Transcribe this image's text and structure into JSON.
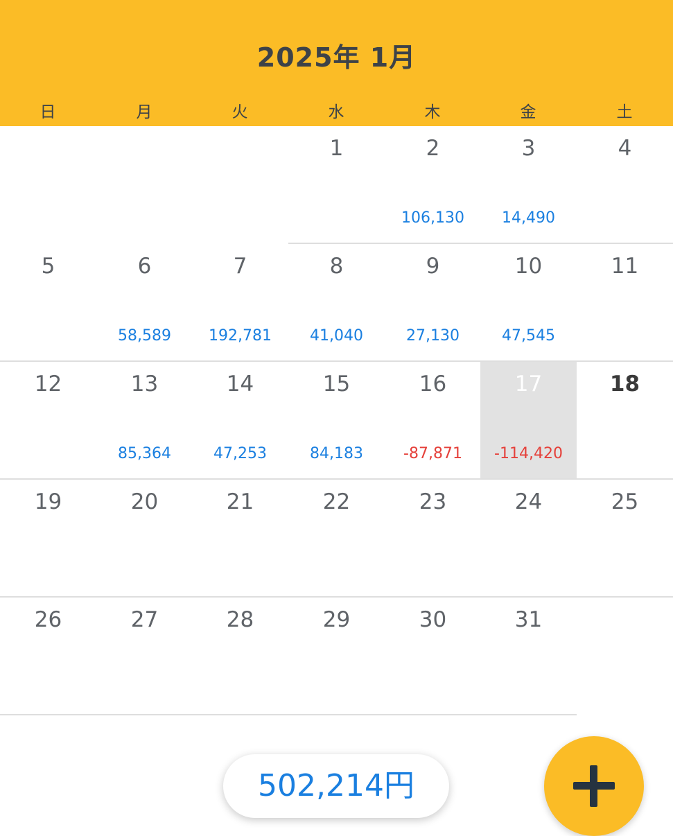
{
  "header": {
    "title": "2025年 1月"
  },
  "colors": {
    "accent": "#FBBC26",
    "positive": "#1a7fe0",
    "negative": "#e5403a",
    "selected": "#e2e2e2"
  },
  "weekdays": [
    "日",
    "月",
    "火",
    "水",
    "木",
    "金",
    "土"
  ],
  "calendar": {
    "weeks": [
      [
        {
          "day": "",
          "amount": ""
        },
        {
          "day": "",
          "amount": ""
        },
        {
          "day": "",
          "amount": ""
        },
        {
          "day": "1",
          "amount": ""
        },
        {
          "day": "2",
          "amount": "106,130"
        },
        {
          "day": "3",
          "amount": "14,490"
        },
        {
          "day": "4",
          "amount": ""
        }
      ],
      [
        {
          "day": "5",
          "amount": ""
        },
        {
          "day": "6",
          "amount": "58,589"
        },
        {
          "day": "7",
          "amount": "192,781"
        },
        {
          "day": "8",
          "amount": "41,040"
        },
        {
          "day": "9",
          "amount": "27,130"
        },
        {
          "day": "10",
          "amount": "47,545"
        },
        {
          "day": "11",
          "amount": ""
        }
      ],
      [
        {
          "day": "12",
          "amount": ""
        },
        {
          "day": "13",
          "amount": "85,364"
        },
        {
          "day": "14",
          "amount": "47,253"
        },
        {
          "day": "15",
          "amount": "84,183"
        },
        {
          "day": "16",
          "amount": "-87,871",
          "negative": true
        },
        {
          "day": "17",
          "amount": "-114,420",
          "negative": true,
          "selected": true
        },
        {
          "day": "18",
          "amount": "",
          "today": true
        }
      ],
      [
        {
          "day": "19",
          "amount": ""
        },
        {
          "day": "20",
          "amount": ""
        },
        {
          "day": "21",
          "amount": ""
        },
        {
          "day": "22",
          "amount": ""
        },
        {
          "day": "23",
          "amount": ""
        },
        {
          "day": "24",
          "amount": ""
        },
        {
          "day": "25",
          "amount": ""
        }
      ],
      [
        {
          "day": "26",
          "amount": ""
        },
        {
          "day": "27",
          "amount": ""
        },
        {
          "day": "28",
          "amount": ""
        },
        {
          "day": "29",
          "amount": ""
        },
        {
          "day": "30",
          "amount": ""
        },
        {
          "day": "31",
          "amount": ""
        },
        {
          "day": "",
          "amount": ""
        }
      ]
    ]
  },
  "total": {
    "label": "502,214円"
  },
  "fab": {
    "icon": "plus-icon"
  }
}
